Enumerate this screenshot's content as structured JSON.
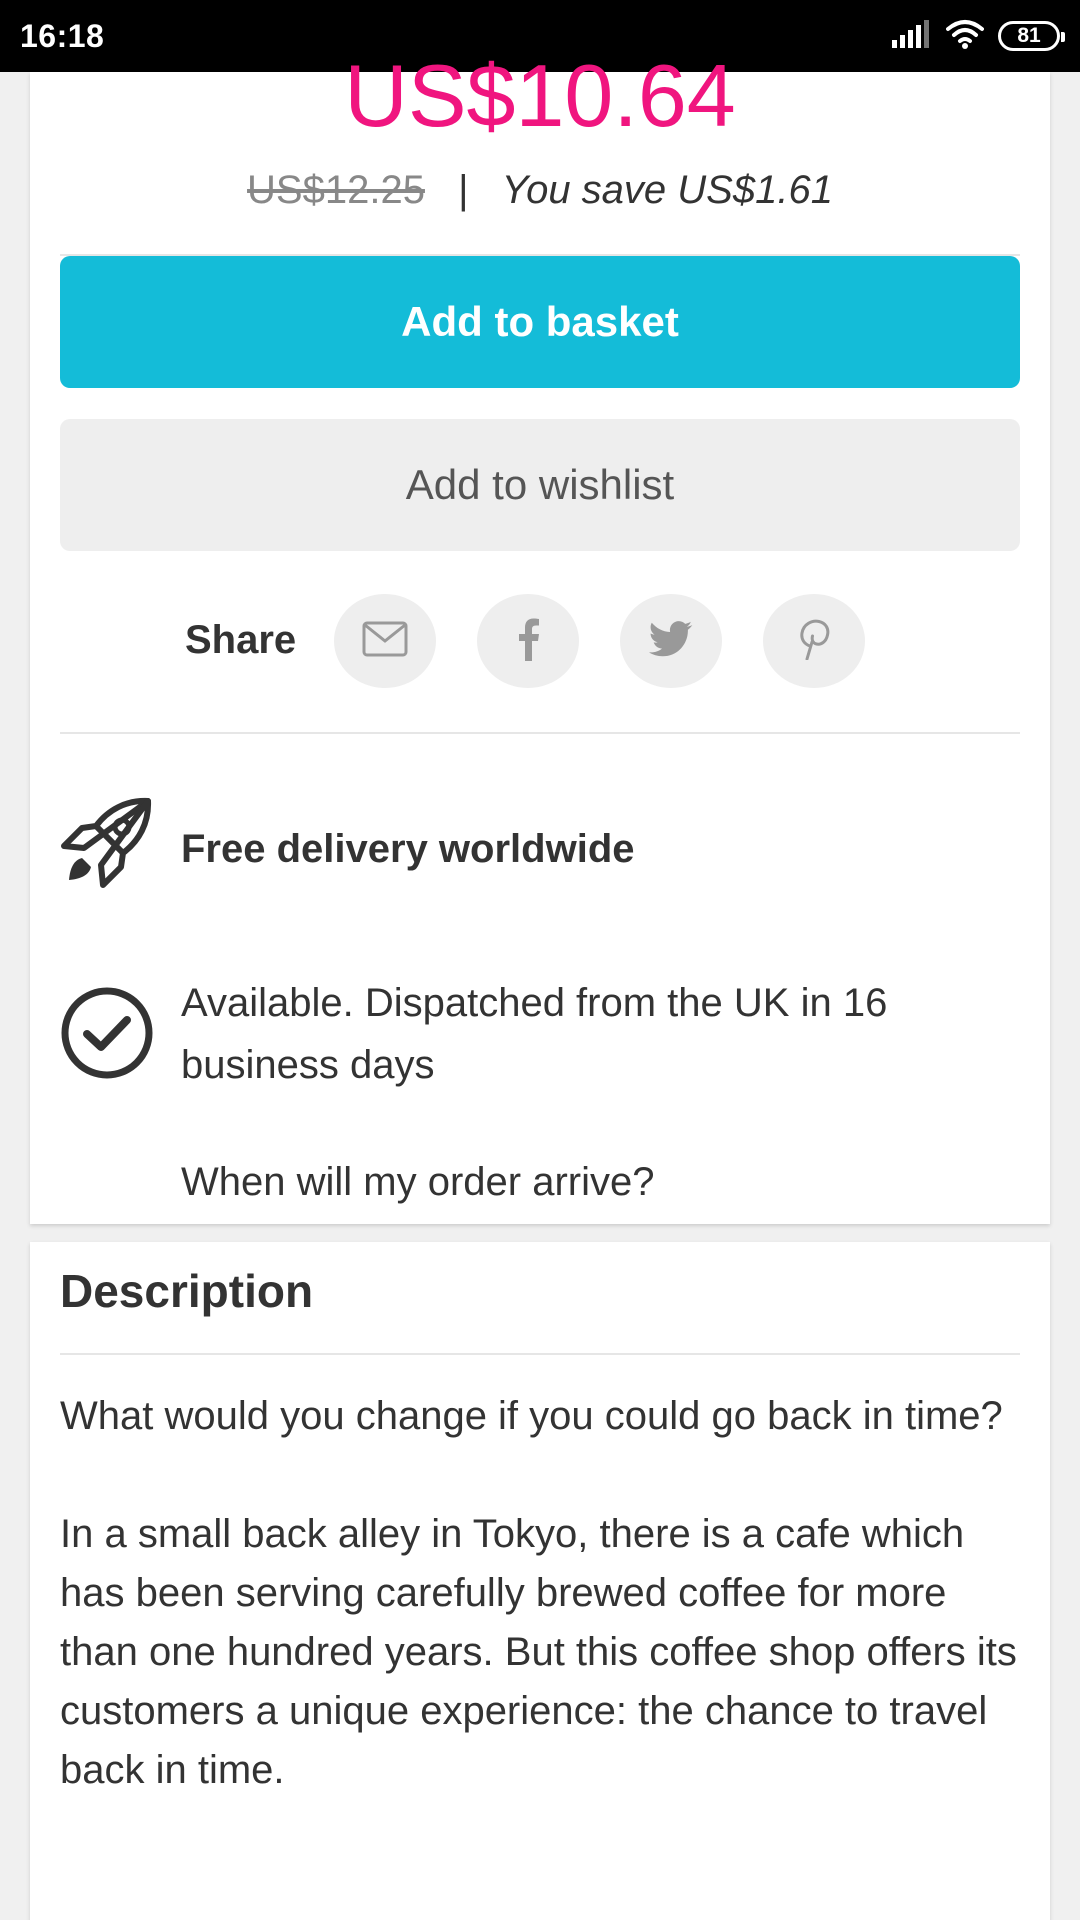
{
  "status_bar": {
    "time": "16:18",
    "battery": "81",
    "icons": [
      "signal-icon",
      "wifi-icon",
      "battery-icon"
    ]
  },
  "product": {
    "price": "US$10.64",
    "old_price": "US$12.25",
    "separator": "|",
    "savings": "You save US$1.61"
  },
  "actions": {
    "add_to_basket": "Add to basket",
    "add_to_wishlist": "Add to wishlist"
  },
  "share": {
    "label": "Share",
    "icons": [
      "email-icon",
      "facebook-icon",
      "twitter-icon",
      "pinterest-icon"
    ]
  },
  "info": {
    "delivery": "Free delivery worldwide",
    "availability": "Available. Dispatched from the UK in 16 business days",
    "arrival_link": "When will my order arrive?"
  },
  "description": {
    "title": "Description",
    "paragraphs": [
      "What would you change if you could go back in time?",
      "In a small back alley in Tokyo, there is a cafe which has been serving carefully brewed coffee for more than one hundred years. But this coffee shop offers its customers a unique experience: the chance to travel back in time."
    ]
  },
  "colors": {
    "price": "#f0157f",
    "basket_button": "#14bcd8",
    "wishlist_button": "#eeeeee",
    "status_bar": "#000000"
  }
}
